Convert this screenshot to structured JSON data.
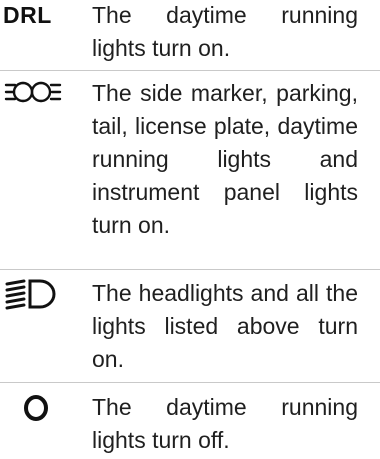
{
  "items": [
    {
      "symbol": "DRL",
      "icon": "drl-text-symbol",
      "text": "The daytime running lights turn on."
    },
    {
      "icon": "side-marker-light-icon",
      "text": "The side marker, parking, tail, license plate, daytime running lights and instrument panel lights turn on."
    },
    {
      "icon": "headlight-icon",
      "text": "The headlights and all the lights listed above turn on."
    },
    {
      "icon": "off-circle-icon",
      "text": "The daytime running lights turn off."
    }
  ]
}
